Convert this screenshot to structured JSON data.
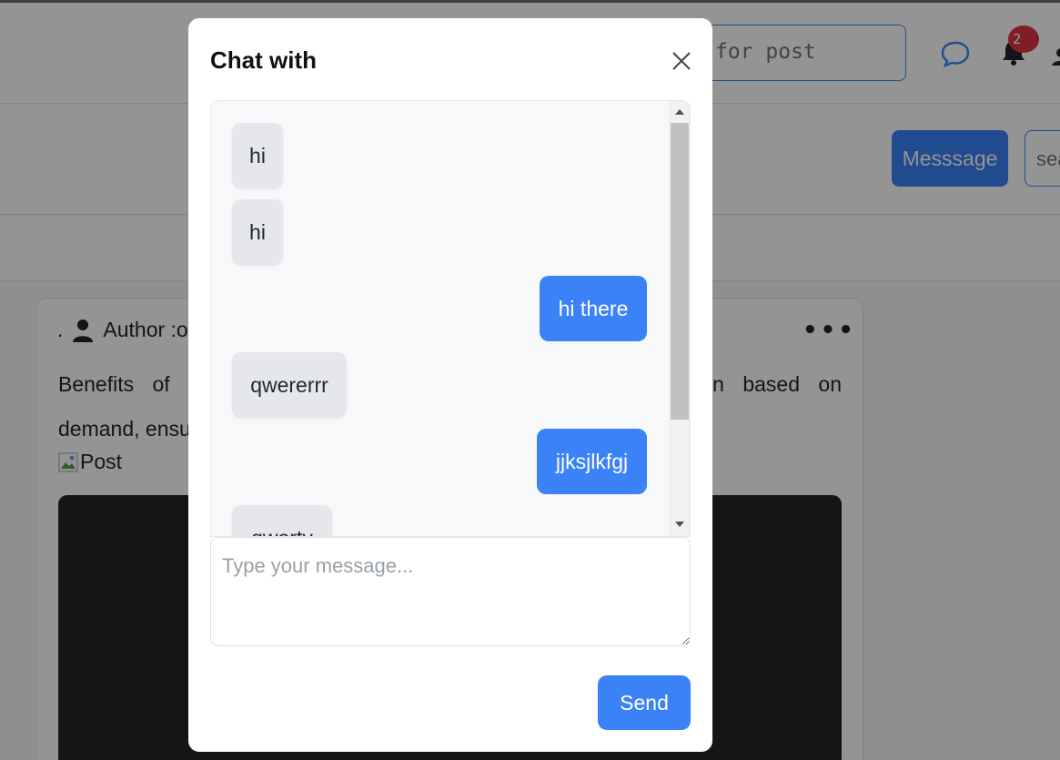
{
  "header": {
    "search_value": "for post",
    "notification_count": "2"
  },
  "subheader": {
    "message_button": "Messsage",
    "search_value": "sea"
  },
  "post": {
    "author_prefix": ".",
    "author_label": "Author :o",
    "more_label": "•••",
    "text_left_line1": "Benefits of C",
    "text_right_line1": "wn based on",
    "text_left_line2": "demand, ensu",
    "image_alt": "Post"
  },
  "modal": {
    "title": "Chat with",
    "messages": [
      {
        "text": "hi",
        "direction": "incoming"
      },
      {
        "text": "hi",
        "direction": "incoming"
      },
      {
        "text": "hi there",
        "direction": "outgoing"
      },
      {
        "text": "qwererrr",
        "direction": "incoming"
      },
      {
        "text": "jjksjlkfgj",
        "direction": "outgoing"
      },
      {
        "text": "qwerty",
        "direction": "incoming"
      }
    ],
    "input_placeholder": "Type your message...",
    "send_label": "Send"
  },
  "colors": {
    "accent": "#3b82f6",
    "incoming_bubble": "#e5e7eb",
    "badge": "#dc3545"
  }
}
